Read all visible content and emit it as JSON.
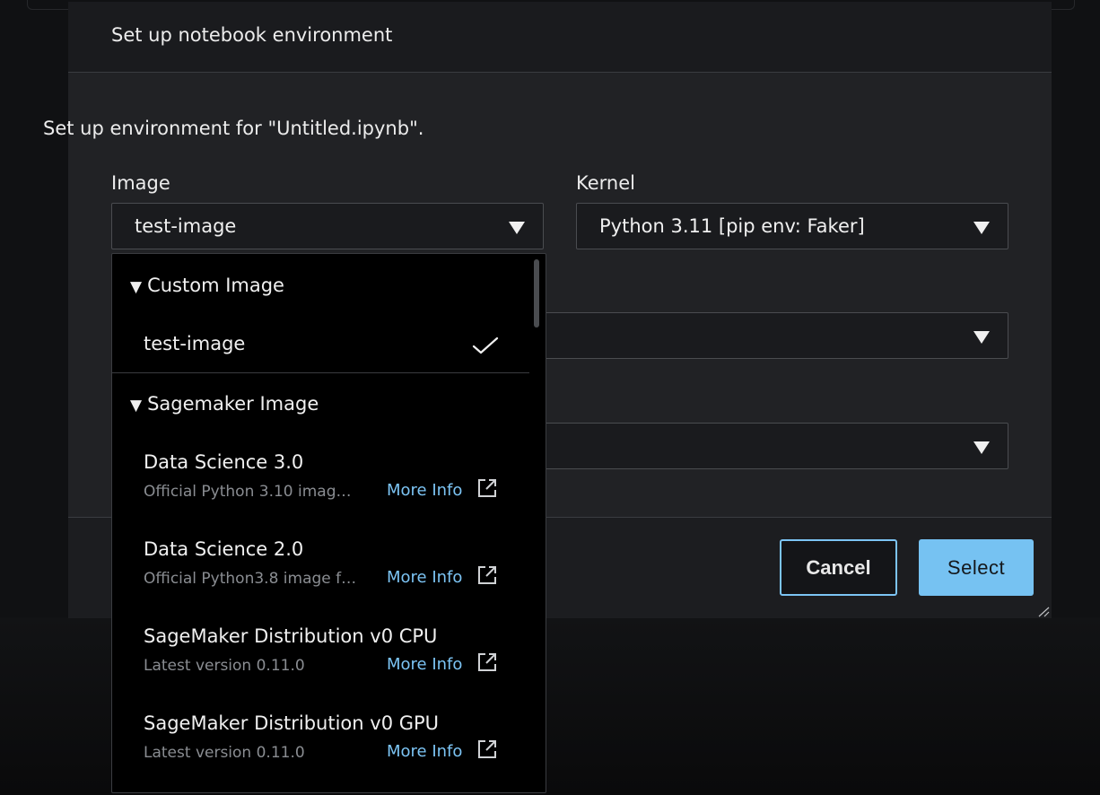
{
  "dialog": {
    "title": "Set up notebook environment",
    "description": "Set up environment for \"Untitled.ipynb\".",
    "image_label": "Image",
    "image_value": "test-image",
    "kernel_label": "Kernel",
    "kernel_value": "Python 3.11 [pip env: Faker]",
    "cancel_label": "Cancel",
    "select_label": "Select"
  },
  "dropdown": {
    "groups": [
      {
        "label": "Custom Image",
        "options": [
          {
            "name": "test-image",
            "selected": true
          }
        ]
      },
      {
        "label": "Sagemaker Image",
        "options": [
          {
            "name": "Data Science 3.0",
            "desc": "Official Python 3.10 imag…",
            "link": "More Info"
          },
          {
            "name": "Data Science 2.0",
            "desc": "Official Python3.8 image f…",
            "link": "More Info"
          },
          {
            "name": "SageMaker Distribution v0 CPU",
            "desc": "Latest version 0.11.0",
            "link": "More Info"
          },
          {
            "name": "SageMaker Distribution v0 GPU",
            "desc": "Latest version 0.11.0",
            "link": "More Info"
          }
        ]
      }
    ]
  },
  "colors": {
    "accent": "#76c2f2",
    "link": "#7cc4f4",
    "background": "#1f2023"
  },
  "icons": [
    "caret-down-icon",
    "check-icon",
    "external-link-icon",
    "resize-grip-icon"
  ]
}
